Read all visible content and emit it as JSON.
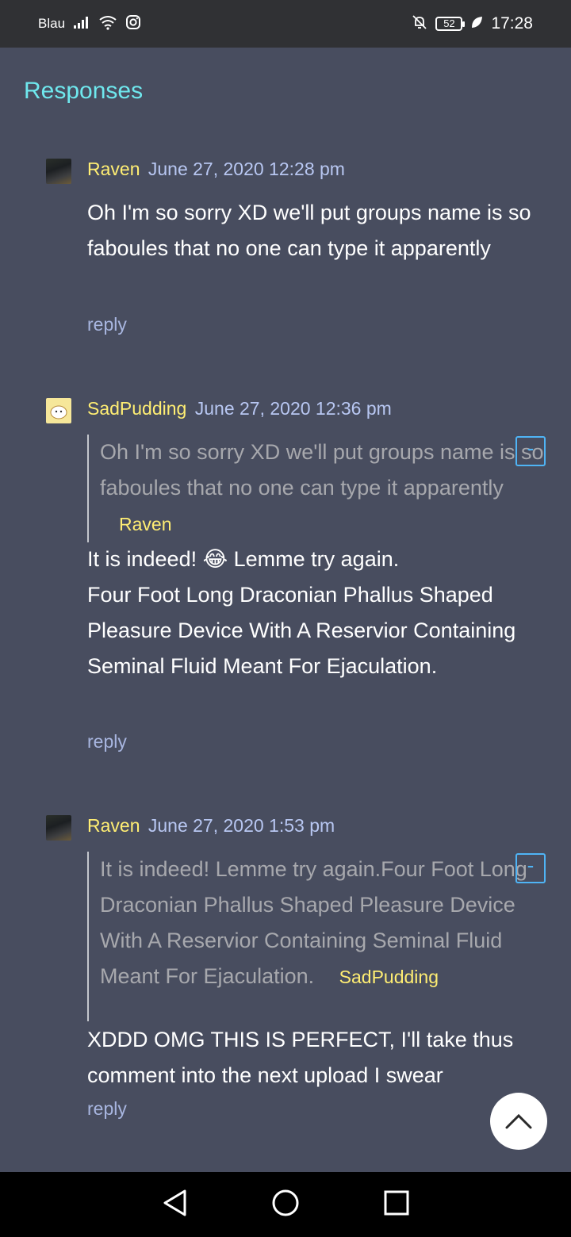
{
  "status_bar": {
    "carrier": "Blau",
    "battery": "52",
    "time": "17:28"
  },
  "page": {
    "title": "Responses"
  },
  "comments": [
    {
      "author": "Raven",
      "date": "June 27, 2020 12:28 pm",
      "text": "Oh I'm so sorry XD we'll put groups name is so faboules that no one can type it apparently",
      "reply_label": "reply"
    },
    {
      "author": "SadPudding",
      "date": "June 27, 2020 12:36 pm",
      "quote": {
        "text": "Oh I'm so sorry XD we'll put groups name is so faboules that no one can type it apparently",
        "author": "Raven",
        "collapse_label": "-"
      },
      "text_line1": "It is indeed! 😂 Lemme try again.",
      "text_line2": "Four Foot Long Draconian Phallus Shaped Pleasure Device With A Reservior Containing Seminal Fluid Meant For Ejaculation.",
      "reply_label": "reply"
    },
    {
      "author": "Raven",
      "date": "June 27, 2020 1:53 pm",
      "quote": {
        "text": "It is indeed! Lemme try again.Four Foot Long Draconian Phallus Shaped Pleasure Device With A Reservior Containing Seminal Fluid Meant For Ejaculation.",
        "author": "SadPudding",
        "collapse_label": "-"
      },
      "text": "XDDD OMG THIS IS PERFECT, I'll take thus comment into the next upload I swear",
      "reply_label": "reply"
    }
  ],
  "colors": {
    "background": "#484d5f",
    "title": "#6fe8ee",
    "author": "#ffee73",
    "date": "#b8c7f2",
    "quote_text": "#a7a8ad",
    "collapse_button": "#4fb4f5"
  },
  "icons": {
    "signal": "signal-icon",
    "wifi": "wifi-icon",
    "instagram": "instagram-icon",
    "mute": "bell-off-icon",
    "leaf": "leaf-icon",
    "scroll_top": "chevron-up-icon",
    "nav_back": "back-triangle-icon",
    "nav_home": "home-circle-icon",
    "nav_recents": "recents-square-icon"
  }
}
